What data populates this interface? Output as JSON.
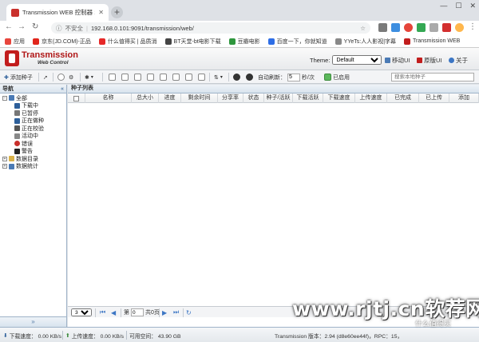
{
  "browser": {
    "tab_title": "Transmission WEB 控制器 1.6.",
    "address_insecure": "不安全",
    "url": "192.168.0.101:9091/transmission/web/",
    "bookmarks": [
      {
        "label": "应用",
        "color": "#e8453c"
      },
      {
        "label": "京东(JD.COM)-正品",
        "color": "#e1251b"
      },
      {
        "label": "什么值得买 | 品质消",
        "color": "#e62828"
      },
      {
        "label": "BT天堂-bt电影下载",
        "color": "#444"
      },
      {
        "label": "豆瓣电影",
        "color": "#2e963d"
      },
      {
        "label": "百度一下，你就知道",
        "color": "#2e6ee6"
      },
      {
        "label": "YYeTs:人人影视|字幕",
        "color": "#888"
      },
      {
        "label": "Transmission WEB",
        "color": "#c21d1d"
      }
    ]
  },
  "header": {
    "logo_title": "Transmission",
    "logo_subtitle": "Web Control",
    "theme_label": "Theme:",
    "theme_value": "Default",
    "links": [
      "移动UI",
      "原版UI",
      "关于"
    ]
  },
  "toolbar": {
    "add_label": "添加种子",
    "speed_label": "自动刷新：",
    "speed_value": "5",
    "speed_unit": "秒/次",
    "enabled_label": "已启用",
    "search_placeholder": "搜索本地种子"
  },
  "sidebar": {
    "title": "导航",
    "collapse_glyph": "«",
    "expand_glyph": "»",
    "items": [
      {
        "label": "全部",
        "level": 0,
        "toggle": "−",
        "icon": "folder-icon",
        "color": "#4a7ab5"
      },
      {
        "label": "下载中",
        "level": 1,
        "icon": "download-icon",
        "color": "#2d5f9a"
      },
      {
        "label": "已暂停",
        "level": 1,
        "icon": "pause-icon",
        "color": "#777"
      },
      {
        "label": "正在做种",
        "level": 1,
        "icon": "upload-icon",
        "color": "#2d5f9a"
      },
      {
        "label": "正在校验",
        "level": 1,
        "icon": "check-icon",
        "color": "#555"
      },
      {
        "label": "活动中",
        "level": 1,
        "icon": "activity-icon",
        "color": "#888"
      },
      {
        "label": "错误",
        "level": 1,
        "icon": "error-icon",
        "color": "#c9302c"
      },
      {
        "label": "警告",
        "level": 1,
        "icon": "warning-icon",
        "color": "#222"
      },
      {
        "label": "数据目录",
        "level": 0,
        "toggle": "+",
        "icon": "folder-icon",
        "color": "#d9b24a"
      },
      {
        "label": "数据统计",
        "level": 0,
        "toggle": "+",
        "icon": "chart-icon",
        "color": "#4a7ab5"
      }
    ]
  },
  "main": {
    "title": "种子列表",
    "columns": [
      "名称",
      "总大小",
      "进度",
      "剩余时间",
      "分享率",
      "状态",
      "种子/活跃",
      "下载活跃",
      "下载速度",
      "上传速度",
      "已完成",
      "已上传",
      "添加"
    ]
  },
  "pager": {
    "page_size": "30",
    "page_label": "第",
    "page_value": "0",
    "total_label": "共0页"
  },
  "status": {
    "download": "下载速度： 0.00 KB/s",
    "upload": "上传速度： 0.00 KB/s",
    "free_space": "可用空间： 43.90 GB",
    "version": "Transmission 版本：2.94 (d8e60ee44f)，RPC：15，",
    "watermark": "www.rjtj.cn软荐网",
    "watermark_small": "什么值得买"
  }
}
